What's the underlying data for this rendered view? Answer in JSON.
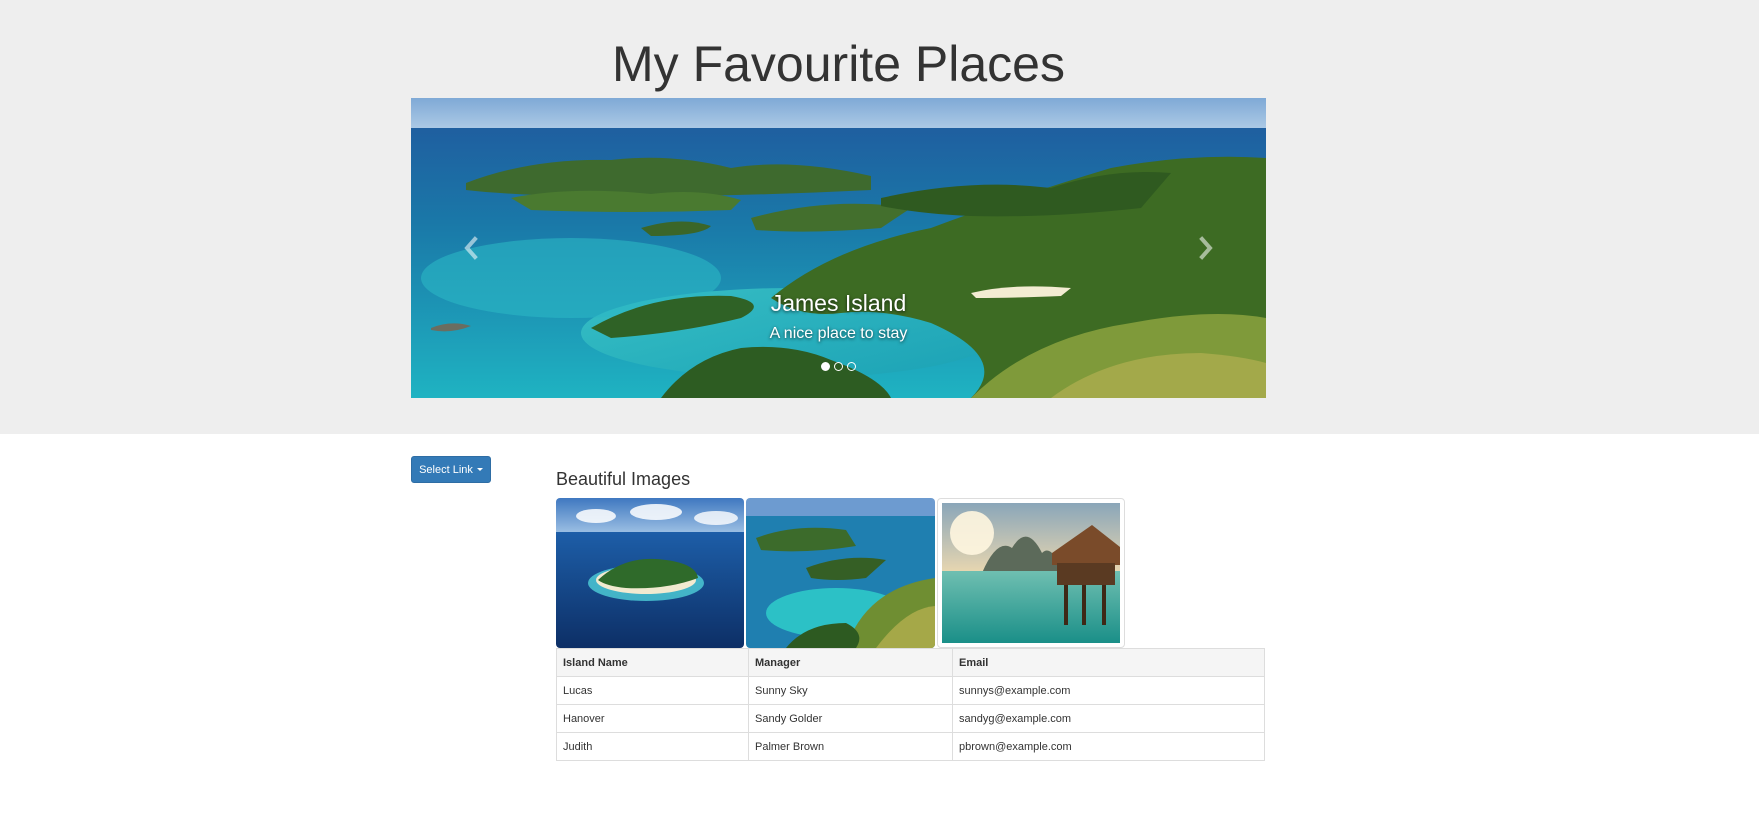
{
  "header": {
    "title": "My Favourite Places"
  },
  "carousel": {
    "caption_title": "James Island",
    "caption_text": "A nice place to stay",
    "prev_icon": "chevron-left-icon",
    "next_icon": "chevron-right-icon",
    "slides_count": 3,
    "active_slide": 1
  },
  "dropdown": {
    "label": "Select Link"
  },
  "gallery": {
    "heading": "Beautiful Images"
  },
  "table": {
    "headers": [
      "Island Name",
      "Manager",
      "Email"
    ],
    "rows": [
      [
        "Lucas",
        "Sunny Sky",
        "sunnys@example.com"
      ],
      [
        "Hanover",
        "Sandy Golder",
        "sandyg@example.com"
      ],
      [
        "Judith",
        "Palmer Brown",
        "pbrown@example.com"
      ]
    ]
  },
  "colors": {
    "jumbotron_bg": "#eeeeee",
    "primary_button": "#337ab7",
    "table_header_bg": "#f5f5f5",
    "border": "#dddddd"
  }
}
